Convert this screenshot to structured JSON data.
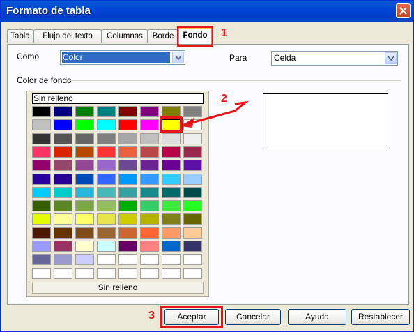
{
  "window": {
    "title": "Formato de tabla"
  },
  "tabs": [
    {
      "label": "Tabla"
    },
    {
      "label": "Flujo del texto"
    },
    {
      "label": "Columnas"
    },
    {
      "label": "Borde"
    },
    {
      "label": "Fondo",
      "active": true
    }
  ],
  "form": {
    "como_label": "Como",
    "como_value": "Color",
    "para_label": "Para",
    "para_value": "Celda",
    "section_label": "Color de fondo"
  },
  "palette": {
    "no_fill_top": "Sin relleno",
    "no_fill_bottom": "Sin relleno",
    "selected": {
      "row": 1,
      "col": 6
    },
    "rows": [
      [
        "#000000",
        "#000080",
        "#008000",
        "#008080",
        "#800000",
        "#800080",
        "#808000",
        "#808080"
      ],
      [
        "#c0c0c0",
        "#0000ff",
        "#00ff00",
        "#00ffff",
        "#ff0000",
        "#ff00ff",
        "#ffff00",
        "#ffffff"
      ],
      [
        "#333333",
        "#555555",
        "#666666",
        "#7f7f7f",
        "#a6a6a6",
        "#c0c0c0",
        "#dddddd",
        "#eeeeee"
      ],
      [
        "#ff3366",
        "#dc2300",
        "#b84700",
        "#ff3333",
        "#eb613d",
        "#b84747",
        "#b80047",
        "#99284c"
      ],
      [
        "#94006b",
        "#94476b",
        "#944794",
        "#9966cc",
        "#6b4794",
        "#6b2394",
        "#6b0094",
        "#5e11a6"
      ],
      [
        "#28009e",
        "#280094",
        "#004ab8",
        "#3366ff",
        "#0099ff",
        "#3399ff",
        "#33ccff",
        "#99ccff"
      ],
      [
        "#00ccff",
        "#00cccc",
        "#23b8dc",
        "#47b8b8",
        "#33a3a3",
        "#198a8a",
        "#006b6b",
        "#004a4a"
      ],
      [
        "#355e00",
        "#5c8526",
        "#7da647",
        "#94bd5e",
        "#00ae00",
        "#33cc66",
        "#3deb3d",
        "#23ff23"
      ],
      [
        "#e6ff00",
        "#ffff99",
        "#ffff66",
        "#e6e64c",
        "#cccc00",
        "#b3b300",
        "#808019",
        "#666600"
      ],
      [
        "#4c1900",
        "#663300",
        "#804c19",
        "#996633",
        "#cc6633",
        "#ff6633",
        "#ff9966",
        "#ffcc99"
      ],
      [
        "#9999ff",
        "#993366",
        "#ffffcc",
        "#ccffff",
        "#660066",
        "#ff8080",
        "#0066cc",
        "#333366"
      ],
      [
        "#666699",
        "#9999cc",
        "#ccccff",
        "#ffffff",
        "#ffffff",
        "#ffffff",
        "#ffffff",
        "#ffffff"
      ],
      [
        "#ffffff",
        "#ffffff",
        "#ffffff",
        "#ffffff",
        "#ffffff",
        "#ffffff",
        "#ffffff",
        "#ffffff"
      ]
    ]
  },
  "buttons": {
    "ok": "Aceptar",
    "cancel": "Cancelar",
    "help": "Ayuda",
    "reset": "Restablecer"
  },
  "annotations": {
    "step1": "1",
    "step2": "2",
    "step3": "3",
    "accent": "#e8141a"
  }
}
